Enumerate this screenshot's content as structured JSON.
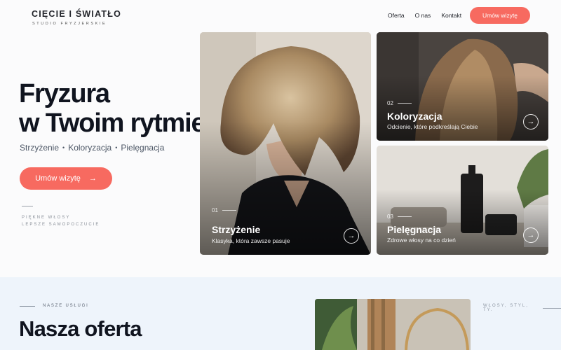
{
  "brand": {
    "name": "CIĘCIE I ŚWIATŁO",
    "subtitle": "STUDIO FRYZJERSKIE"
  },
  "nav": {
    "items": [
      "Oferta",
      "O nas",
      "Kontakt"
    ],
    "cta": "Umów wizytę"
  },
  "hero": {
    "title_line1": "Fryzura",
    "title_line2": "w Twoim rytmie",
    "services": [
      "Strzyżenie",
      "Koloryzacja",
      "Pielęgnacja"
    ],
    "separator": "•",
    "cta": "Umów wizytę",
    "cta_arrow": "→",
    "tagline_line1": "PIĘKNE WŁOSY",
    "tagline_line2": "LEPSZE SAMOPOCZUCIE"
  },
  "cards": [
    {
      "num": "01",
      "title": "Strzyżenie",
      "desc": "Klasyka, która zawsze pasuje",
      "arrow": "→"
    },
    {
      "num": "02",
      "title": "Koloryzacja",
      "desc": "Odcienie, które podkreślają Ciebie",
      "arrow": "→"
    },
    {
      "num": "03",
      "title": "Pielęgnacja",
      "desc": "Zdrowe włosy na co dzień",
      "arrow": "→"
    }
  ],
  "offer": {
    "label": "NASZE USŁUGI",
    "title": "Nasza oferta",
    "side_label": "WŁOSY, STYL, TY."
  },
  "colors": {
    "accent": "#f76a60",
    "dark": "#10141f",
    "section_bg": "#eef4fb"
  }
}
